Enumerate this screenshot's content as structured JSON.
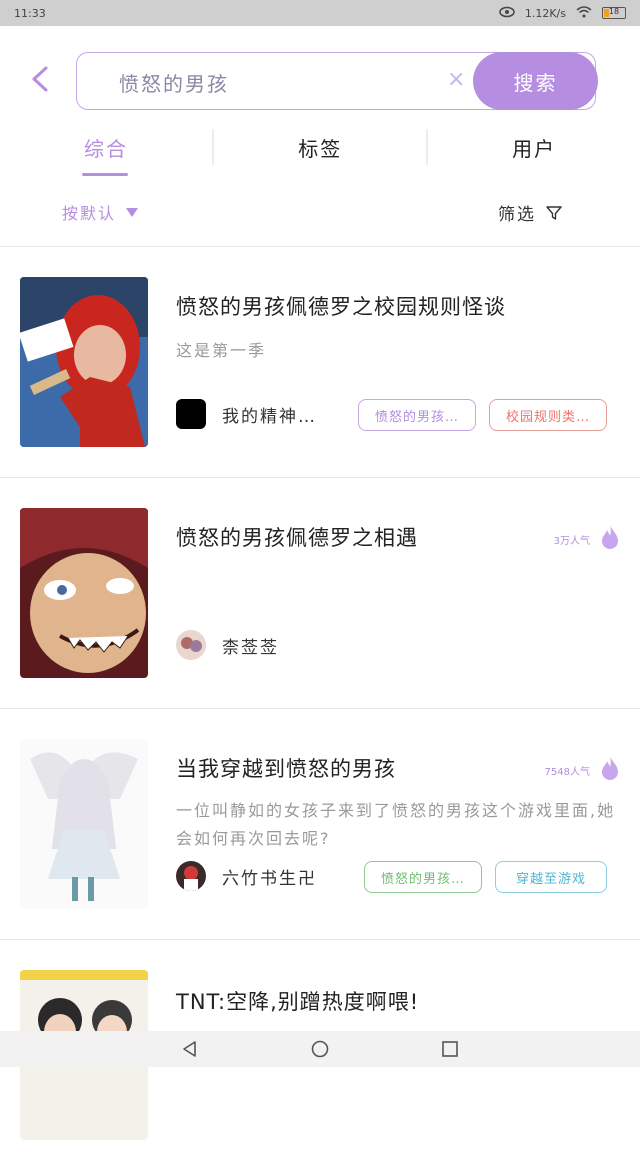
{
  "status": {
    "time": "11:33",
    "speed": "1.12K/s",
    "battery": "18"
  },
  "search": {
    "value": "愤怒的男孩",
    "button": "搜索"
  },
  "tabs": [
    {
      "label": "综合"
    },
    {
      "label": "标签"
    },
    {
      "label": "用户"
    }
  ],
  "filters": {
    "sort": "按默认",
    "filter": "筛选"
  },
  "items": [
    {
      "title": "愤怒的男孩佩德罗之校园规则怪谈",
      "subtitle": "这是第一季",
      "heat": "",
      "author": "我的精神…",
      "tags": [
        {
          "label": "愤怒的男孩…",
          "color": "#b58de1"
        },
        {
          "label": "校园规则类…",
          "color": "#e6776f"
        }
      ]
    },
    {
      "title": "愤怒的男孩佩德罗之相遇",
      "subtitle": "",
      "heat": "3万人气",
      "author": "柰莶莶",
      "tags": []
    },
    {
      "title": "当我穿越到愤怒的男孩",
      "subtitle": "一位叫静如的女孩子来到了愤怒的男孩这个游戏里面,她会如何再次回去呢?",
      "heat": "7548人气",
      "author": "六竹书生卍",
      "tags": [
        {
          "label": "愤怒的男孩…",
          "color": "#6fbf73"
        },
        {
          "label": "穿越至游戏",
          "color": "#4cb6d1"
        }
      ]
    },
    {
      "title": "TNT:空降,别蹭热度啊喂!",
      "subtitle": "",
      "heat": "",
      "author": "",
      "tags": []
    }
  ],
  "colors": {
    "accent": "#b58de1"
  }
}
